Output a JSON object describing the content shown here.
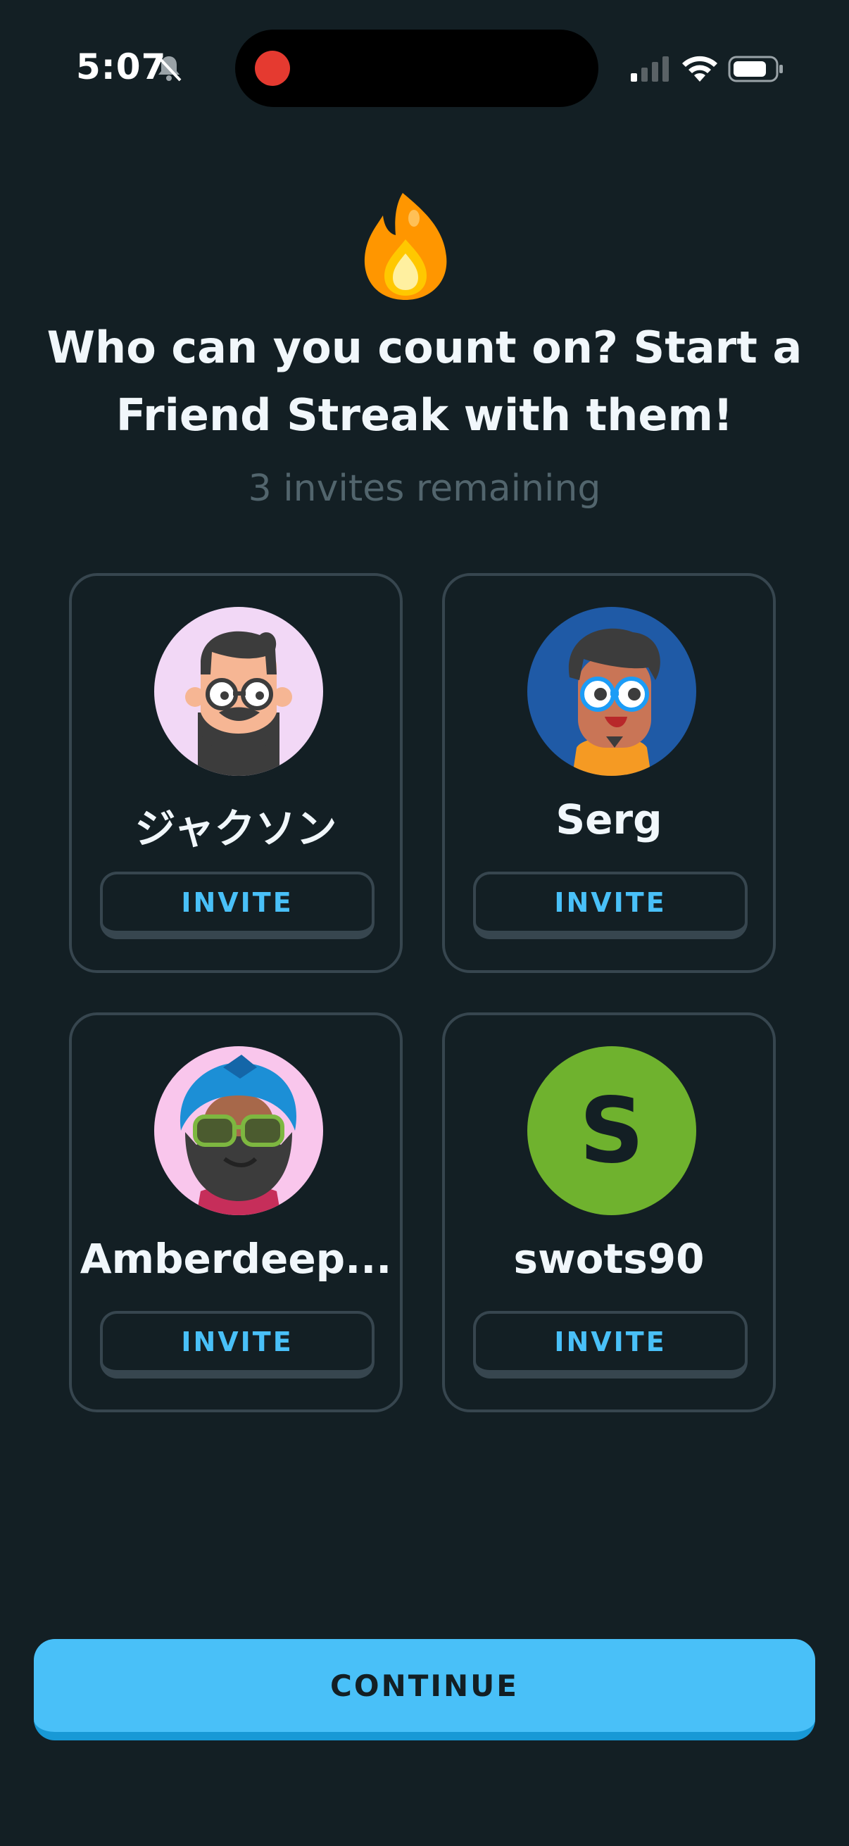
{
  "status_bar": {
    "time": "5:07",
    "icons": [
      "bell-muted-icon",
      "recording-dot-icon",
      "cellular-signal-icon",
      "wifi-icon",
      "battery-icon"
    ]
  },
  "header": {
    "icon": "flame-icon",
    "title": "Who can you count on? Start a Friend Streak with them!",
    "subtitle": "3 invites remaining"
  },
  "friends": [
    {
      "name": "ジャクソン",
      "avatar": "illustrated-avatar-bearded-glasses",
      "invite_label": "INVITE"
    },
    {
      "name": "Serg",
      "avatar": "illustrated-avatar-glasses-blue",
      "invite_label": "INVITE"
    },
    {
      "name": "Amberdeep...",
      "avatar": "illustrated-avatar-turban-sunglasses",
      "invite_label": "INVITE"
    },
    {
      "name": "swots90",
      "avatar_letter": "S",
      "invite_label": "INVITE"
    }
  ],
  "continue_label": "CONTINUE",
  "colors": {
    "background": "#131f24",
    "card_border": "#37464f",
    "accent_blue": "#49c0f8",
    "accent_blue_shadow": "#1899d6",
    "subtext": "#52656d",
    "letter_avatar": "#6fb22e"
  }
}
